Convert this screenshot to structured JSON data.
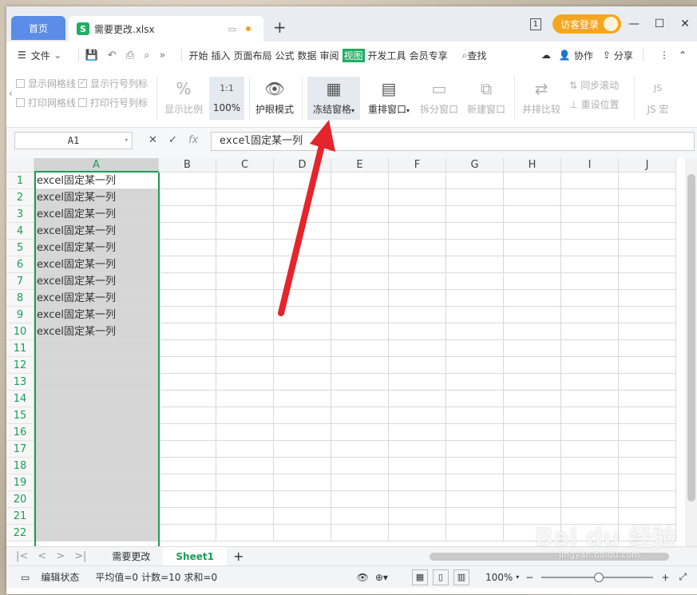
{
  "titlebar": {
    "home_tab": "首页",
    "doc_tab": "需要更改.xlsx",
    "new_tab": "+",
    "layout_btn": "1",
    "visitor_login": "访客登录"
  },
  "menu": {
    "file": "文件",
    "tabs": [
      "开始",
      "插入",
      "页面布局",
      "公式",
      "数据",
      "审阅",
      "视图",
      "开发工具",
      "会员专享"
    ],
    "active_tab": "视图",
    "search": "查找",
    "collab": "协作",
    "share": "分享"
  },
  "ribbon": {
    "show_gridlines": "显示网格线",
    "show_row_col_headers": "显示行号列标",
    "print_gridlines": "打印网格线",
    "print_row_col_headers": "打印行号列标",
    "show_ratio": "显示比例",
    "zoom_100_icon": "1:1",
    "zoom_100": "100%",
    "eye_mode": "护眼模式",
    "freeze_panes": "冻结窗格",
    "arrange_windows": "重排窗口",
    "split_window": "拆分窗口",
    "new_window": "新建窗口",
    "side_by_side": "并排比较",
    "sync_scroll": "同步滚动",
    "reset_position": "重设位置",
    "js_macro": "JS 宏"
  },
  "formula_bar": {
    "name_box": "A1",
    "fx": "fx",
    "content": "excel固定某一列"
  },
  "grid": {
    "columns": [
      "A",
      "B",
      "C",
      "D",
      "E",
      "F",
      "G",
      "H",
      "I",
      "J"
    ],
    "rows": [
      "1",
      "2",
      "3",
      "4",
      "5",
      "6",
      "7",
      "8",
      "9",
      "10",
      "11",
      "12",
      "13",
      "14",
      "15",
      "16",
      "17",
      "18",
      "19",
      "20",
      "21",
      "22"
    ],
    "column_a_values": [
      "excel固定某一列",
      "excel固定某一列",
      "excel固定某一列",
      "excel固定某一列",
      "excel固定某一列",
      "excel固定某一列",
      "excel固定某一列",
      "excel固定某一列",
      "excel固定某一列",
      "excel固定某一列"
    ],
    "selected_column": "A",
    "accent": "#1a9e56"
  },
  "sheets": {
    "tabs": [
      "需要更改",
      "Sheet1"
    ],
    "active": "Sheet1",
    "add": "+"
  },
  "status": {
    "mode": "编辑状态",
    "average": "平均值=0",
    "count": "计数=10",
    "sum": "求和=0",
    "zoom": "100%"
  },
  "watermark": {
    "logo": "Bai du 经验",
    "url": "jingyan.baidu.com"
  }
}
